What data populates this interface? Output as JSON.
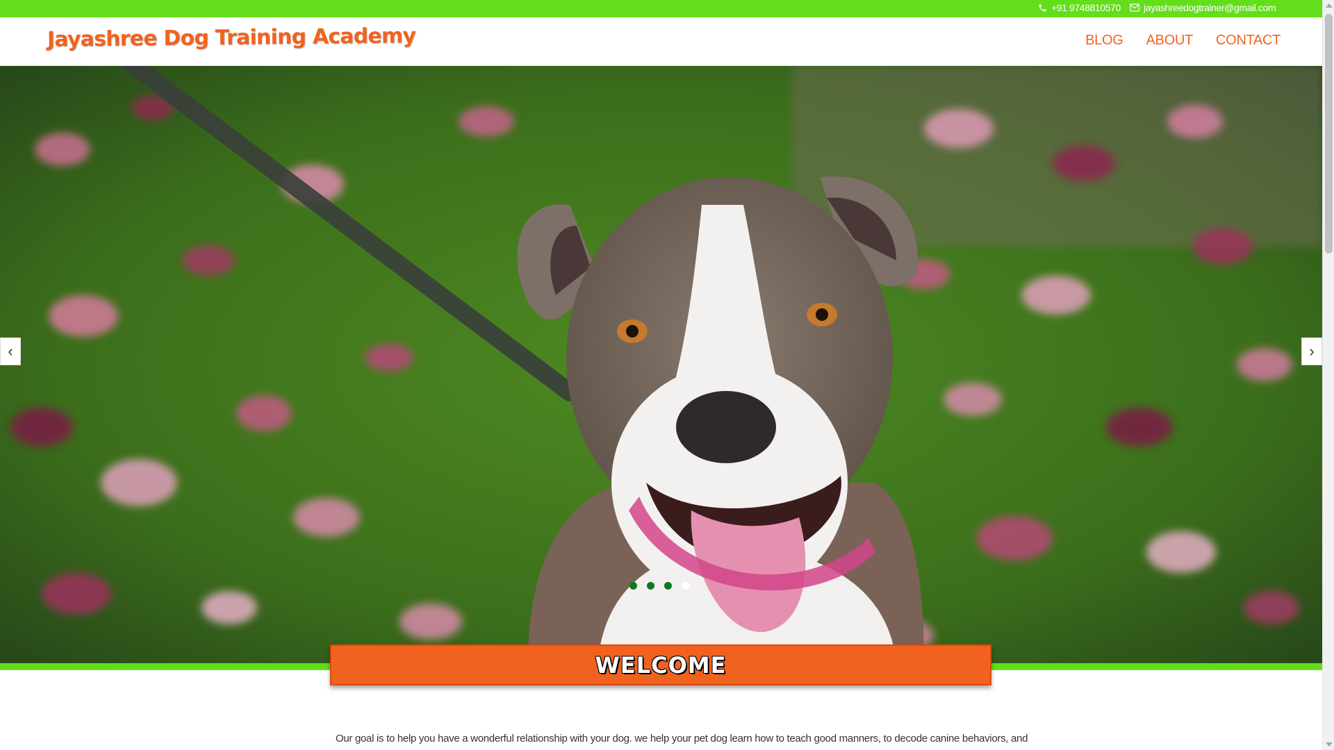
{
  "topbar": {
    "phone": "+91 9748810570",
    "email": "jayashreedogtrainer@gmail.com",
    "phone_icon": "phone-icon",
    "email_icon": "envelope-icon",
    "color": "#62de1a"
  },
  "header": {
    "logo_text": "Jayashree Dog Training Academy",
    "nav": [
      {
        "label": "BLOG"
      },
      {
        "label": "ABOUT"
      },
      {
        "label": "CONTACT"
      }
    ],
    "accent_color": "#f2621f"
  },
  "slider": {
    "prev_label": "‹",
    "next_label": "›",
    "slide_count": 4,
    "active_slide": 4,
    "image_description_icon": "dog-photo"
  },
  "welcome": {
    "title": "WELCOME"
  },
  "intro": {
    "text": "Our goal is to help you have a wonderful relationship with your dog. we help your pet dog learn how to teach good manners, to decode canine behaviors, and"
  }
}
